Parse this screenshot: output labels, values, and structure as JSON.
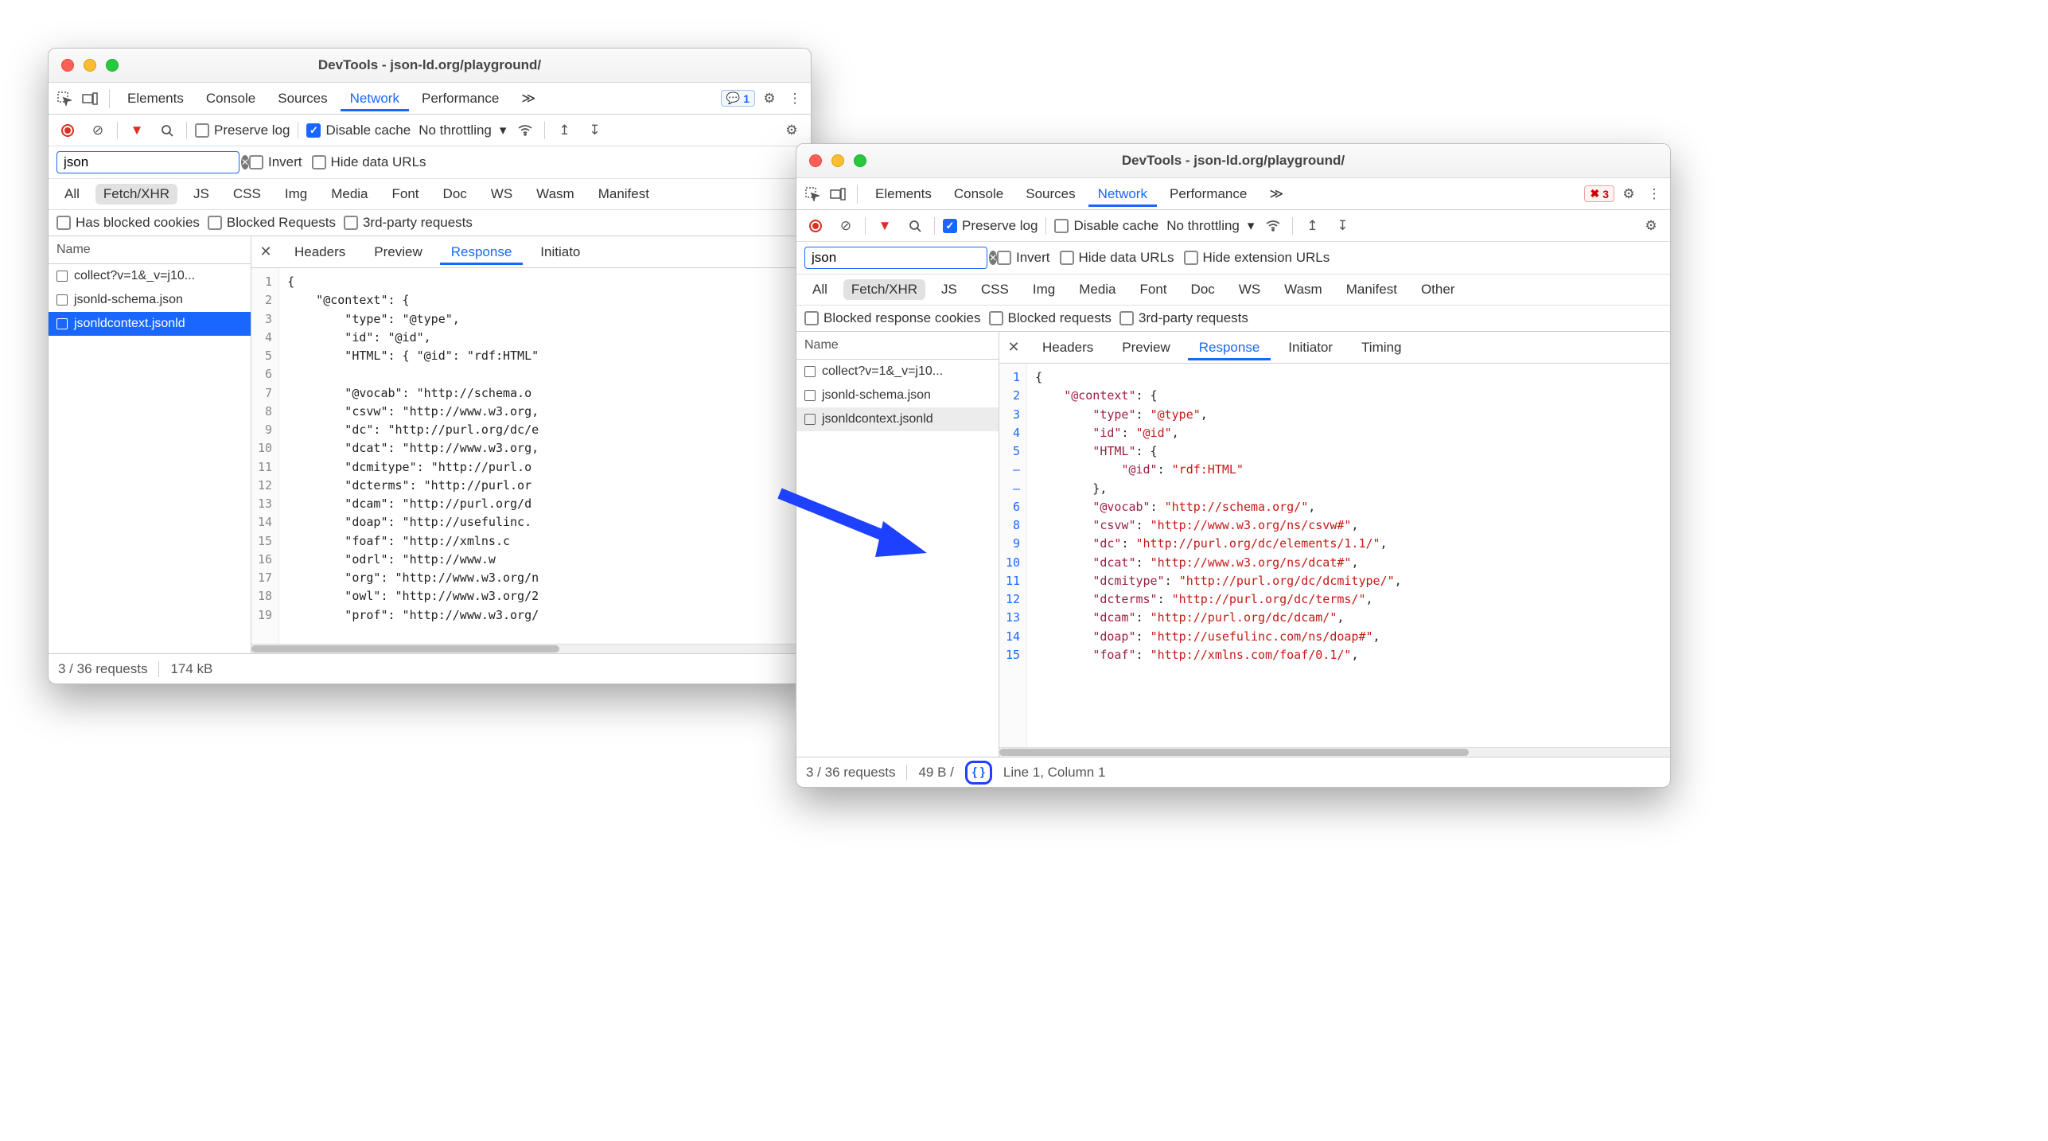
{
  "left": {
    "title": "DevTools - json-ld.org/playground/",
    "tabs": [
      "Elements",
      "Console",
      "Sources",
      "Network",
      "Performance"
    ],
    "active_tab": "Network",
    "issues_count": "1",
    "toolbar": {
      "preserve_label": "Preserve log",
      "preserve_checked": false,
      "disable_label": "Disable cache",
      "disable_checked": true,
      "throttle": "No throttling"
    },
    "filter_value": "json",
    "invert": "Invert",
    "hide_urls": "Hide data URLs",
    "types": [
      "All",
      "Fetch/XHR",
      "JS",
      "CSS",
      "Img",
      "Media",
      "Font",
      "Doc",
      "WS",
      "Wasm",
      "Manifest"
    ],
    "type_active": "Fetch/XHR",
    "extra_filters": [
      "Has blocked cookies",
      "Blocked Requests",
      "3rd-party requests"
    ],
    "name_header": "Name",
    "requests": [
      "collect?v=1&_v=j10...",
      "jsonld-schema.json",
      "jsonldcontext.jsonld"
    ],
    "selected_request": 2,
    "detail_tabs": [
      "Headers",
      "Preview",
      "Response",
      "Initiato"
    ],
    "detail_active": "Response",
    "gutter": "1\n2\n3\n4\n5\n6\n7\n8\n9\n10\n11\n12\n13\n14\n15\n16\n17\n18\n19",
    "code_lines": [
      "{",
      "    \"@context\": {",
      "        \"type\": \"@type\",",
      "        \"id\": \"@id\",",
      "        \"HTML\": { \"@id\": \"rdf:HTML\"",
      "",
      "        \"@vocab\": \"http://schema.o",
      "        \"csvw\": \"http://www.w3.org,",
      "        \"dc\": \"http://purl.org/dc/e",
      "        \"dcat\": \"http://www.w3.org,",
      "        \"dcmitype\": \"http://purl.o",
      "        \"dcterms\": \"http://purl.or",
      "        \"dcam\": \"http://purl.org/d",
      "        \"doap\": \"http://usefulinc.",
      "        \"foaf\": \"http://xmlns.c",
      "        \"odrl\": \"http://www.w",
      "        \"org\": \"http://www.w3.org/n",
      "        \"owl\": \"http://www.w3.org/2",
      "        \"prof\": \"http://www.w3.org/"
    ],
    "status_req": "3 / 36 requests",
    "status_size": "174 kB"
  },
  "right": {
    "title": "DevTools - json-ld.org/playground/",
    "tabs": [
      "Elements",
      "Console",
      "Sources",
      "Network",
      "Performance"
    ],
    "active_tab": "Network",
    "errors_count": "3",
    "toolbar": {
      "preserve_label": "Preserve log",
      "preserve_checked": true,
      "disable_label": "Disable cache",
      "disable_checked": false,
      "throttle": "No throttling"
    },
    "filter_value": "json",
    "invert": "Invert",
    "hide_urls": "Hide data URLs",
    "hide_ext": "Hide extension URLs",
    "types": [
      "All",
      "Fetch/XHR",
      "JS",
      "CSS",
      "Img",
      "Media",
      "Font",
      "Doc",
      "WS",
      "Wasm",
      "Manifest",
      "Other"
    ],
    "type_active": "Fetch/XHR",
    "extra_filters": [
      "Blocked response cookies",
      "Blocked requests",
      "3rd-party requests"
    ],
    "name_header": "Name",
    "requests": [
      "collect?v=1&_v=j10...",
      "jsonld-schema.json",
      "jsonldcontext.jsonld"
    ],
    "selected_request": 2,
    "detail_tabs": [
      "Headers",
      "Preview",
      "Response",
      "Initiator",
      "Timing"
    ],
    "detail_active": "Response",
    "gutter": "1\n2\n3\n4\n5\n–\n–\n6\n8\n9\n10\n11\n12\n13\n14\n15",
    "code_lines": [
      [
        "{"
      ],
      [
        "    ",
        "\"@context\"",
        ": {"
      ],
      [
        "        ",
        "\"type\"",
        ": ",
        "\"@type\"",
        ","
      ],
      [
        "        ",
        "\"id\"",
        ": ",
        "\"@id\"",
        ","
      ],
      [
        "        ",
        "\"HTML\"",
        ": {"
      ],
      [
        "            ",
        "\"@id\"",
        ": ",
        "\"rdf:HTML\""
      ],
      [
        "        },"
      ],
      [
        "        ",
        "\"@vocab\"",
        ": ",
        "\"http://schema.org/\"",
        ","
      ],
      [
        "        ",
        "\"csvw\"",
        ": ",
        "\"http://www.w3.org/ns/csvw#\"",
        ","
      ],
      [
        "        ",
        "\"dc\"",
        ": ",
        "\"http://purl.org/dc/elements/1.1/\"",
        ","
      ],
      [
        "        ",
        "\"dcat\"",
        ": ",
        "\"http://www.w3.org/ns/dcat#\"",
        ","
      ],
      [
        "        ",
        "\"dcmitype\"",
        ": ",
        "\"http://purl.org/dc/dcmitype/\"",
        ","
      ],
      [
        "        ",
        "\"dcterms\"",
        ": ",
        "\"http://purl.org/dc/terms/\"",
        ","
      ],
      [
        "        ",
        "\"dcam\"",
        ": ",
        "\"http://purl.org/dc/dcam/\"",
        ","
      ],
      [
        "        ",
        "\"doap\"",
        ": ",
        "\"http://usefulinc.com/ns/doap#\"",
        ","
      ],
      [
        "        ",
        "\"foaf\"",
        ": ",
        "\"http://xmlns.com/foaf/0.1/\"",
        ","
      ]
    ],
    "status_req": "3 / 36 requests",
    "status_size": "49 B /",
    "status_pos": "Line 1, Column 1"
  }
}
